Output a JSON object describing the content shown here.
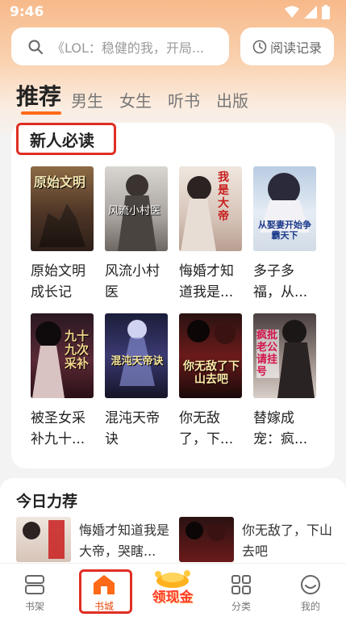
{
  "status": {
    "time": "9:46"
  },
  "search": {
    "placeholder": "《LOL：稳健的我，开局..."
  },
  "history": {
    "label": "阅读记录"
  },
  "tabs": [
    {
      "label": "推荐"
    },
    {
      "label": "男生"
    },
    {
      "label": "女生"
    },
    {
      "label": "听书"
    },
    {
      "label": "出版"
    }
  ],
  "section": {
    "title": "新人必读"
  },
  "books": [
    {
      "title": "原始文明成长记",
      "cover_text": "原始文明"
    },
    {
      "title": "风流小村医",
      "cover_text": "风流小村医"
    },
    {
      "title": "悔婚才知道我是...",
      "cover_text": "我是大帝"
    },
    {
      "title": "多子多福，从...",
      "cover_text": "从娶妻开始争霸天下"
    },
    {
      "title": "被圣女采补九十...",
      "cover_text": "九十九次采补"
    },
    {
      "title": "混沌天帝诀",
      "cover_text": "混沌天帝诀"
    },
    {
      "title": "你无敌了，下...",
      "cover_text": "你无敌了下山去吧"
    },
    {
      "title": "替嫁成宠：疯...",
      "cover_text": "疯批老公请挂号"
    }
  ],
  "today": {
    "title": "今日力荐",
    "items": [
      {
        "title": "悔婚才知道我是大帝，哭瞎..."
      },
      {
        "title": "你无敌了，下山去吧"
      }
    ]
  },
  "nav": {
    "bookshelf": "书架",
    "bookstore": "书城",
    "cash": "领现金",
    "category": "分类",
    "mine": "我的"
  },
  "colors": {
    "accent": "#ff6a18",
    "highlight_box": "#e02e24"
  }
}
